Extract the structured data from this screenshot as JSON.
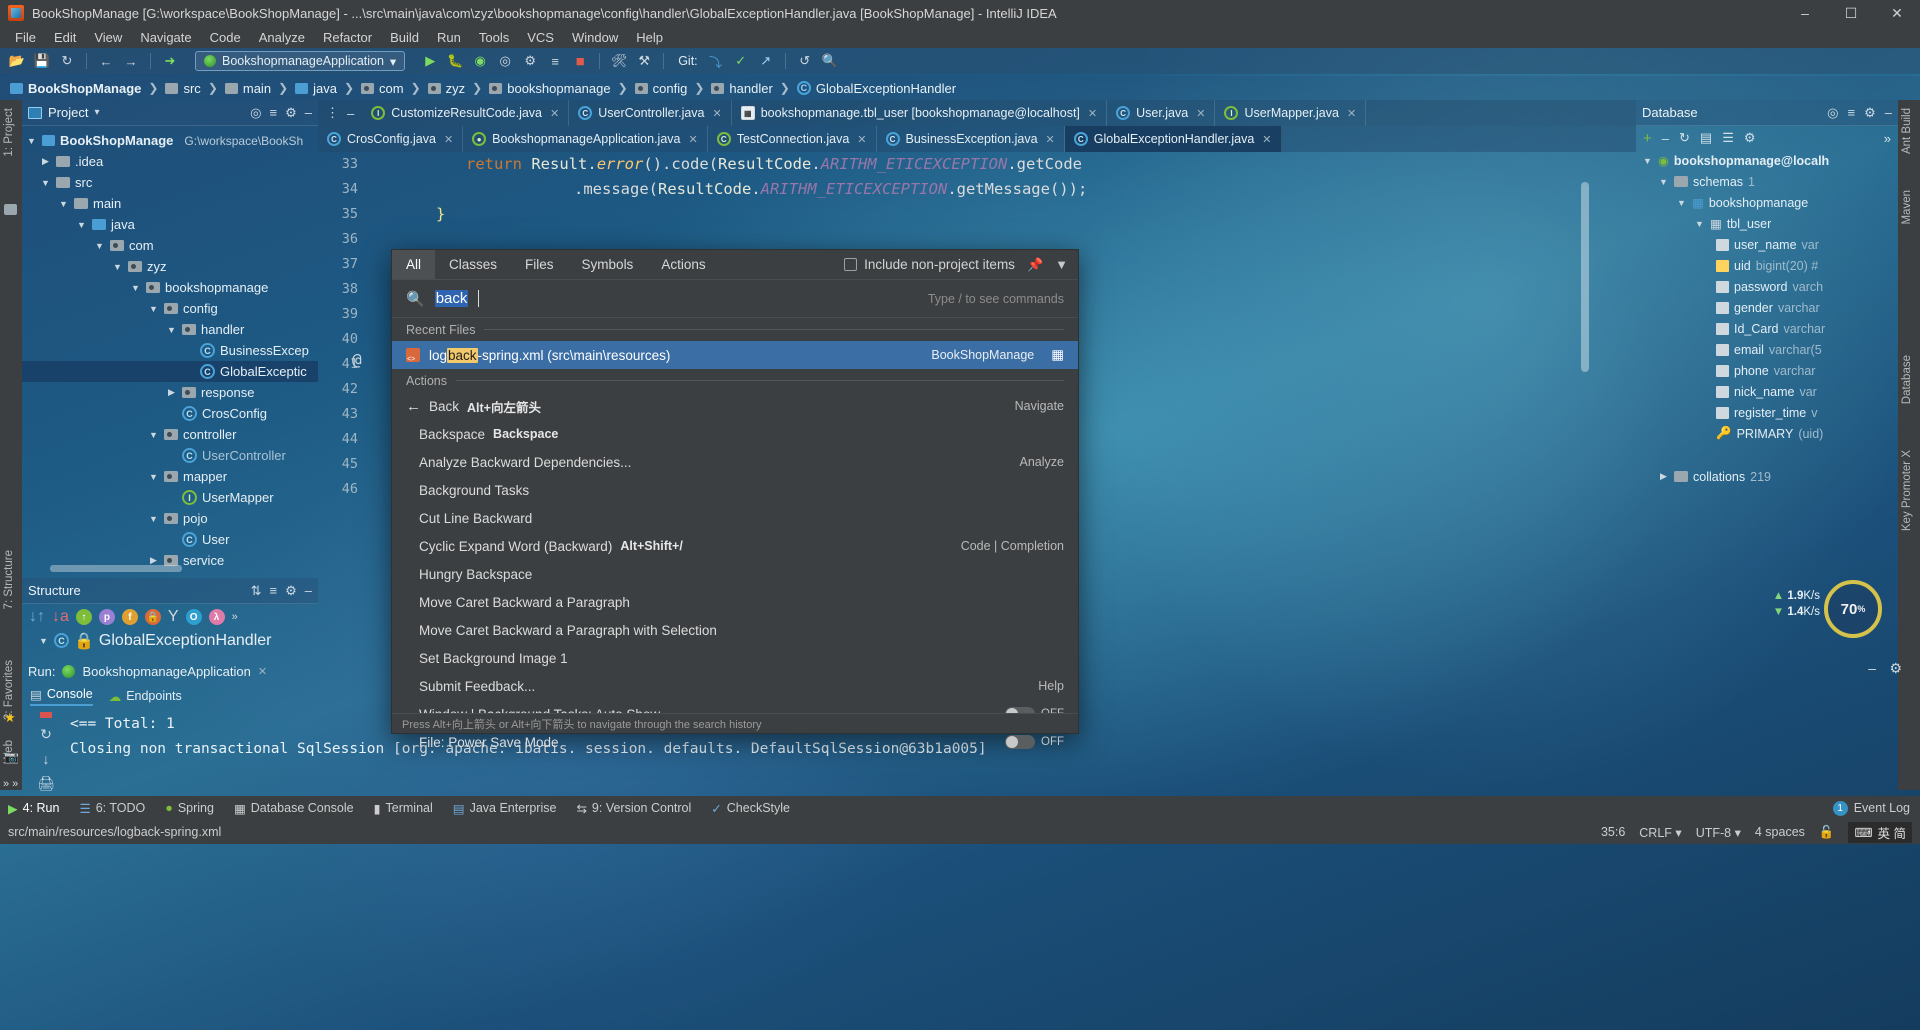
{
  "window": {
    "title": "BookShopManage [G:\\workspace\\BookShopManage] - ...\\src\\main\\java\\com\\zyz\\bookshopmanage\\config\\handler\\GlobalExceptionHandler.java [BookShopManage] - IntelliJ IDEA",
    "minimize": "–",
    "maximize": "☐",
    "close": "✕"
  },
  "menu": [
    "File",
    "Edit",
    "View",
    "Navigate",
    "Code",
    "Analyze",
    "Refactor",
    "Build",
    "Run",
    "Tools",
    "VCS",
    "Window",
    "Help"
  ],
  "toolbar": {
    "run_config": "BookshopmanageApplication",
    "git_label": "Git:",
    "icons": [
      "open-folder-icon",
      "save-icon",
      "sync-icon",
      "back-arrow-icon",
      "forward-arrow-icon",
      "undo-icon",
      "run-icon",
      "debug-icon",
      "run-with-coverage-icon",
      "profile-icon",
      "rerun-icon",
      "stop-icon",
      "build-icon",
      "settings-icon",
      "update-project-icon",
      "commit-icon",
      "push-icon",
      "search-icon"
    ]
  },
  "breadcrumb": [
    {
      "label": "BookShopManage",
      "icon": "module-icon"
    },
    {
      "label": "src",
      "icon": "folder-icon"
    },
    {
      "label": "main",
      "icon": "folder-icon"
    },
    {
      "label": "java",
      "icon": "source-root-icon"
    },
    {
      "label": "com",
      "icon": "package-icon"
    },
    {
      "label": "zyz",
      "icon": "package-icon"
    },
    {
      "label": "bookshopmanage",
      "icon": "package-icon"
    },
    {
      "label": "config",
      "icon": "package-icon"
    },
    {
      "label": "handler",
      "icon": "package-icon"
    },
    {
      "label": "GlobalExceptionHandler",
      "icon": "class-icon"
    }
  ],
  "left_rail": [
    "1: Project",
    "7: Structure",
    "2: Favorites",
    "Web"
  ],
  "right_rail": [
    "Ant Build",
    "Maven",
    "Database",
    "Key Promoter X"
  ],
  "project_panel": {
    "title": "Project",
    "root": {
      "label": "BookShopManage",
      "path": "G:\\workspace\\BookSh"
    },
    "tree": [
      {
        "label": ".idea",
        "indent": 1,
        "arrow": "▶",
        "icon": "folder"
      },
      {
        "label": "src",
        "indent": 1,
        "arrow": "▼",
        "icon": "folder"
      },
      {
        "label": "main",
        "indent": 2,
        "arrow": "▼",
        "icon": "folder"
      },
      {
        "label": "java",
        "indent": 3,
        "arrow": "▼",
        "icon": "folder-blue"
      },
      {
        "label": "com",
        "indent": 4,
        "arrow": "▼",
        "icon": "package"
      },
      {
        "label": "zyz",
        "indent": 5,
        "arrow": "▼",
        "icon": "package"
      },
      {
        "label": "bookshopmanage",
        "indent": 6,
        "arrow": "▼",
        "icon": "package"
      },
      {
        "label": "config",
        "indent": 7,
        "arrow": "▼",
        "icon": "package"
      },
      {
        "label": "handler",
        "indent": 8,
        "arrow": "▼",
        "icon": "package"
      },
      {
        "label": "BusinessExcep",
        "indent": 9,
        "arrow": "",
        "icon": "class"
      },
      {
        "label": "GlobalExceptic",
        "indent": 9,
        "arrow": "",
        "icon": "class",
        "selected": true
      },
      {
        "label": "response",
        "indent": 8,
        "arrow": "▶",
        "icon": "package"
      },
      {
        "label": "CrosConfig",
        "indent": 8,
        "arrow": "",
        "icon": "class"
      },
      {
        "label": "controller",
        "indent": 7,
        "arrow": "▼",
        "icon": "package"
      },
      {
        "label": "UserController",
        "indent": 8,
        "arrow": "",
        "icon": "class",
        "dimmed": true
      },
      {
        "label": "mapper",
        "indent": 7,
        "arrow": "▼",
        "icon": "package"
      },
      {
        "label": "UserMapper",
        "indent": 8,
        "arrow": "",
        "icon": "interface"
      },
      {
        "label": "pojo",
        "indent": 7,
        "arrow": "▼",
        "icon": "package"
      },
      {
        "label": "User",
        "indent": 8,
        "arrow": "",
        "icon": "class"
      },
      {
        "label": "service",
        "indent": 7,
        "arrow": "▶",
        "icon": "package"
      }
    ]
  },
  "structure_panel": {
    "title": "Structure",
    "item": "GlobalExceptionHandler"
  },
  "editor_tabs_row1": [
    {
      "label": "CustomizeResultCode.java",
      "icon": "interface"
    },
    {
      "label": "UserController.java",
      "icon": "class"
    },
    {
      "label": "bookshopmanage.tbl_user [bookshopmanage@localhost]",
      "icon": "table"
    },
    {
      "label": "User.java",
      "icon": "class"
    },
    {
      "label": "UserMapper.java",
      "icon": "interface"
    }
  ],
  "editor_tabs_row2": [
    {
      "label": "CrosConfig.java",
      "icon": "class"
    },
    {
      "label": "BookshopmanageApplication.java",
      "icon": "spring"
    },
    {
      "label": "TestConnection.java",
      "icon": "spring"
    },
    {
      "label": "BusinessException.java",
      "icon": "class"
    },
    {
      "label": "GlobalExceptionHandler.java",
      "icon": "class",
      "active": true
    }
  ],
  "editor": {
    "line_numbers": [
      "33",
      "34",
      "35",
      "36",
      "37",
      "38",
      "39",
      "40",
      "41",
      "42",
      "43",
      "44",
      "45",
      "46"
    ],
    "lines": [
      "return Result.error().code(ResultCode.ARITHM_ETICEXCEPTION.getCode",
      "        .message(ResultCode.ARITHM_ETICEXCEPTION.getMessage());",
      "}"
    ],
    "annotation_symbol": "@"
  },
  "database_panel": {
    "title": "Database",
    "connection": "bookshopmanage@localh",
    "schemas_label": "schemas",
    "schemas_count": "1",
    "schema": "bookshopmanage",
    "table": "tbl_user",
    "columns": [
      {
        "name": "user_name",
        "type": "var"
      },
      {
        "name": "uid",
        "type": "bigint(20) #"
      },
      {
        "name": "password",
        "type": "varch"
      },
      {
        "name": "gender",
        "type": "varchar"
      },
      {
        "name": "Id_Card",
        "type": "varchar"
      },
      {
        "name": "email",
        "type": "varchar(5"
      },
      {
        "name": "phone",
        "type": "varchar"
      },
      {
        "name": "nick_name",
        "type": "var"
      },
      {
        "name": "register_time",
        "type": "v"
      },
      {
        "name": "PRIMARY",
        "type": "(uid)",
        "key": true
      }
    ],
    "collations_label": "collations",
    "collations_count": "219"
  },
  "search_everywhere": {
    "tabs": [
      "All",
      "Classes",
      "Files",
      "Symbols",
      "Actions"
    ],
    "active_tab": "All",
    "include_non_project_label": "Include non-project items",
    "query": "back",
    "placeholder": "Type / to see commands",
    "type_hint": "Type / to see commands",
    "recent_files_group": "Recent Files",
    "recent_files": [
      {
        "prefix": "log",
        "highlight": "back",
        "suffix": "-spring.xml (src\\main\\resources)",
        "right": "BookShopManage",
        "selected": true
      }
    ],
    "actions_group": "Actions",
    "actions": [
      {
        "label": "Back",
        "shortcut": "Alt+向左箭头",
        "right": "Navigate",
        "icon": "back-arrow-icon"
      },
      {
        "label": "Backspace",
        "shortcut": "Backspace",
        "right": ""
      },
      {
        "label": "Analyze Backward Dependencies...",
        "shortcut": "",
        "right": "Analyze"
      },
      {
        "label": "Background Tasks",
        "shortcut": "",
        "right": ""
      },
      {
        "label": "Cut Line Backward",
        "shortcut": "",
        "right": ""
      },
      {
        "label": "Cyclic Expand Word (Backward)",
        "shortcut": "Alt+Shift+/",
        "right": "Code | Completion"
      },
      {
        "label": "Hungry Backspace",
        "shortcut": "",
        "right": ""
      },
      {
        "label": "Move Caret Backward a Paragraph",
        "shortcut": "",
        "right": ""
      },
      {
        "label": "Move Caret Backward a Paragraph with Selection",
        "shortcut": "",
        "right": ""
      },
      {
        "label": "Set Background Image 1",
        "shortcut": "",
        "right": ""
      },
      {
        "label": "Submit Feedback...",
        "shortcut": "",
        "right": "Help"
      },
      {
        "label": "Window | Background Tasks: Auto Show",
        "shortcut": "",
        "right": "",
        "toggle": "OFF"
      },
      {
        "label": "File: Power Save Mode",
        "shortcut": "",
        "right": "",
        "toggle": "OFF"
      }
    ],
    "footer": "Press Alt+向上箭头 or Alt+向下箭头 to navigate through the search history"
  },
  "run_panel": {
    "run_label": "Run:",
    "config": "BookshopmanageApplication",
    "tabs": [
      {
        "label": "Console",
        "icon": "console-icon",
        "active": true
      },
      {
        "label": "Endpoints",
        "icon": "endpoints-icon"
      }
    ],
    "console_lines": [
      "<==      Total: 1",
      "Closing non transactional SqlSession [org. apache. ibatis. session. defaults. DefaultSqlSession@63b1a005]"
    ]
  },
  "bottom_tool_window": [
    {
      "label": "4: Run",
      "icon": "run-icon",
      "active": true
    },
    {
      "label": "6: TODO",
      "icon": "todo-icon"
    },
    {
      "label": "Spring",
      "icon": "spring-icon"
    },
    {
      "label": "Database Console",
      "icon": "db-console-icon"
    },
    {
      "label": "Terminal",
      "icon": "terminal-icon"
    },
    {
      "label": "Java Enterprise",
      "icon": "java-ee-icon"
    },
    {
      "label": "9: Version Control",
      "icon": "vcs-icon"
    },
    {
      "label": "CheckStyle",
      "icon": "checkstyle-icon"
    }
  ],
  "event_log": {
    "label": "Event Log",
    "count": "1"
  },
  "status_bar": {
    "left": "src/main/resources/logback-spring.xml",
    "caret": "35:6",
    "line_sep": "CRLF",
    "encoding": "UTF-8",
    "indent": "4 spaces",
    "ime": "英 简"
  },
  "network_monitor": {
    "upload": "1.9",
    "upload_unit": "K/s",
    "download": "1.4",
    "download_unit": "K/s",
    "cpu": "70",
    "cpu_unit": "%"
  }
}
